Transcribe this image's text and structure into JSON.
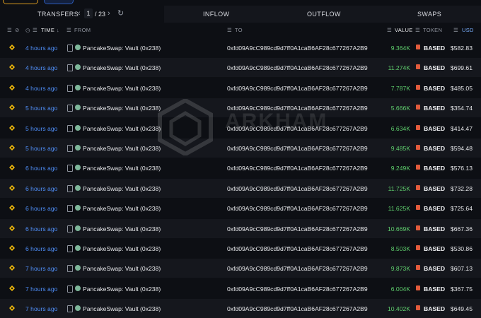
{
  "tabs": {
    "transfers": "TRANSFERS",
    "page_current": "1",
    "page_total": "/ 23",
    "inflow": "INFLOW",
    "outflow": "OUTFLOW",
    "swaps": "SWAPS"
  },
  "columns": {
    "time": "TIME",
    "from": "FROM",
    "to": "TO",
    "value": "VALUE",
    "token": "TOKEN",
    "usd": "USD"
  },
  "watermark": "ARKHAM",
  "colors": {
    "time_link": "#4f8ef7",
    "value_green": "#5fce6d",
    "token_icon": "#e25b3c",
    "chain_icon": "#f0b90b"
  },
  "rows": [
    {
      "time": "4 hours ago",
      "from": "PancakeSwap: Vault (0x238)",
      "to": "0xfd09A9cC989cd9d7ff0A1caB6AF28c677267A2B9",
      "value": "9.364K",
      "token": "BASED",
      "usd": "$582.83"
    },
    {
      "time": "4 hours ago",
      "from": "PancakeSwap: Vault (0x238)",
      "to": "0xfd09A9cC989cd9d7ff0A1caB6AF28c677267A2B9",
      "value": "11.274K",
      "token": "BASED",
      "usd": "$699.61"
    },
    {
      "time": "4 hours ago",
      "from": "PancakeSwap: Vault (0x238)",
      "to": "0xfd09A9cC989cd9d7ff0A1caB6AF28c677267A2B9",
      "value": "7.787K",
      "token": "BASED",
      "usd": "$485.05"
    },
    {
      "time": "5 hours ago",
      "from": "PancakeSwap: Vault (0x238)",
      "to": "0xfd09A9cC989cd9d7ff0A1caB6AF28c677267A2B9",
      "value": "5.666K",
      "token": "BASED",
      "usd": "$354.74"
    },
    {
      "time": "5 hours ago",
      "from": "PancakeSwap: Vault (0x238)",
      "to": "0xfd09A9cC989cd9d7ff0A1caB6AF28c677267A2B9",
      "value": "6.634K",
      "token": "BASED",
      "usd": "$414.47"
    },
    {
      "time": "5 hours ago",
      "from": "PancakeSwap: Vault (0x238)",
      "to": "0xfd09A9cC989cd9d7ff0A1caB6AF28c677267A2B9",
      "value": "9.485K",
      "token": "BASED",
      "usd": "$594.48"
    },
    {
      "time": "6 hours ago",
      "from": "PancakeSwap: Vault (0x238)",
      "to": "0xfd09A9cC989cd9d7ff0A1caB6AF28c677267A2B9",
      "value": "9.249K",
      "token": "BASED",
      "usd": "$576.13"
    },
    {
      "time": "6 hours ago",
      "from": "PancakeSwap: Vault (0x238)",
      "to": "0xfd09A9cC989cd9d7ff0A1caB6AF28c677267A2B9",
      "value": "11.725K",
      "token": "BASED",
      "usd": "$732.28"
    },
    {
      "time": "6 hours ago",
      "from": "PancakeSwap: Vault (0x238)",
      "to": "0xfd09A9cC989cd9d7ff0A1caB6AF28c677267A2B9",
      "value": "11.625K",
      "token": "BASED",
      "usd": "$725.64"
    },
    {
      "time": "6 hours ago",
      "from": "PancakeSwap: Vault (0x238)",
      "to": "0xfd09A9cC989cd9d7ff0A1caB6AF28c677267A2B9",
      "value": "10.669K",
      "token": "BASED",
      "usd": "$667.36"
    },
    {
      "time": "6 hours ago",
      "from": "PancakeSwap: Vault (0x238)",
      "to": "0xfd09A9cC989cd9d7ff0A1caB6AF28c677267A2B9",
      "value": "8.503K",
      "token": "BASED",
      "usd": "$530.86"
    },
    {
      "time": "7 hours ago",
      "from": "PancakeSwap: Vault (0x238)",
      "to": "0xfd09A9cC989cd9d7ff0A1caB6AF28c677267A2B9",
      "value": "9.873K",
      "token": "BASED",
      "usd": "$607.13"
    },
    {
      "time": "7 hours ago",
      "from": "PancakeSwap: Vault (0x238)",
      "to": "0xfd09A9cC989cd9d7ff0A1caB6AF28c677267A2B9",
      "value": "6.004K",
      "token": "BASED",
      "usd": "$367.75"
    },
    {
      "time": "7 hours ago",
      "from": "PancakeSwap: Vault (0x238)",
      "to": "0xfd09A9cC989cd9d7ff0A1caB6AF28c677267A2B9",
      "value": "10.402K",
      "token": "BASED",
      "usd": "$649.45"
    }
  ]
}
